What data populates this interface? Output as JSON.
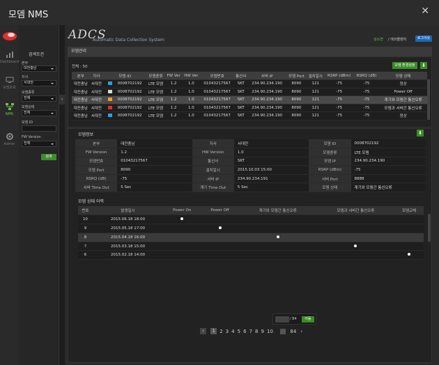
{
  "window": {
    "title": "모뎀 NMS"
  },
  "nav": {
    "items": [
      {
        "label": "Dashboard"
      },
      {
        "label": "모뎀조회"
      },
      {
        "label": "NMS"
      },
      {
        "label": "Admin"
      }
    ]
  },
  "filter": {
    "title": "검색조건",
    "hq_label": "본부",
    "hq_value": "대전충남",
    "office_label": "지사",
    "office_value": "서대전",
    "type_label": "모뎀종류",
    "type_value": "전체",
    "state_label": "모뎀상태",
    "state_value": "전체",
    "id_label": "모뎀 ID",
    "id_value": "",
    "fw_label": "FW Version",
    "fw_value": "전체",
    "search_label": "검색"
  },
  "header": {
    "logo": "ADCS",
    "subtitle": "Automatic Data Collection System",
    "crumb_user": "김소연",
    "crumb_rest": "/ 에코몰랜저",
    "logout": "로그아웃"
  },
  "modem_panel": {
    "title": "모뎀관리",
    "total": "전체 : 50",
    "setting_button": "모뎀 환경설정",
    "columns": [
      "본부",
      "지사",
      "모뎀 ID",
      "모뎀종류",
      "FW Ver",
      "HW Ver",
      "모뎀번호",
      "통신사",
      "서버 IP",
      "모뎀 Port",
      "설치일시",
      "RSRP (dBm)",
      "RSRQ (dB)",
      "모뎀 상태"
    ],
    "rows": [
      {
        "hq": "대전충남",
        "office": "서대전",
        "color": "#2aa2e0",
        "id": "0008702192",
        "type": "LTE 모뎀",
        "fw": "1.2",
        "hw": "1.0",
        "num": "01043217567",
        "telco": "SKT",
        "ip": "234.90.234.190",
        "port": "8090",
        "inst": "121",
        "rsrp": "-75",
        "rsrq": "-75",
        "state": "정상"
      },
      {
        "hq": "대전충남",
        "office": "서대전",
        "color": "#d8d8d8",
        "id": "0008702192",
        "type": "LTE 모뎀",
        "fw": "1.2",
        "hw": "1.0",
        "num": "01043217567",
        "telco": "SKT",
        "ip": "234.90.234.190",
        "port": "8090",
        "inst": "121",
        "rsrp": "-75",
        "rsrq": "-75",
        "state": "Power Off"
      },
      {
        "hq": "대전충남",
        "office": "서대전",
        "color": "#f0a020",
        "id": "0008702192",
        "type": "LTE 모뎀",
        "fw": "1.2",
        "hw": "1.0",
        "num": "01043217567",
        "telco": "SKT",
        "ip": "234.90.234.190",
        "port": "8090",
        "inst": "121",
        "rsrp": "-75",
        "rsrq": "-75",
        "state": "계기와 모뎀간 통신오류"
      },
      {
        "hq": "대전충남",
        "office": "서대전",
        "color": "#e03030",
        "id": "0008702192",
        "type": "LTE 모뎀",
        "fw": "1.2",
        "hw": "1.0",
        "num": "01043217567",
        "telco": "SKT",
        "ip": "234.90.234.190",
        "port": "8090",
        "inst": "121",
        "rsrp": "-75",
        "rsrq": "-75",
        "state": "모뎀과 서버간 통신오류"
      },
      {
        "hq": "대전충남",
        "office": "서대전",
        "color": "#2aa2e0",
        "id": "0008702192",
        "type": "LTE 모뎀",
        "fw": "1.2",
        "hw": "1.0",
        "num": "01043217567",
        "telco": "SKT",
        "ip": "234.90.234.190",
        "port": "8090",
        "inst": "121",
        "rsrp": "-75",
        "rsrq": "-75",
        "state": "정상"
      }
    ]
  },
  "info": {
    "title": "모뎀정보",
    "rows": [
      [
        [
          "본부",
          "대전충남"
        ],
        [
          "지사",
          "서대전"
        ],
        [
          "모뎀 ID",
          "0008702192"
        ]
      ],
      [
        [
          "FW Version",
          "1.2"
        ],
        [
          "HW Version",
          "1.0"
        ],
        [
          "모뎀종류",
          "LTE 모뎀"
        ]
      ],
      [
        [
          "모뎀번호",
          "01043217567"
        ],
        [
          "통신사",
          "SKT"
        ],
        [
          "모뎀 IP",
          "234.90.234.190"
        ]
      ],
      [
        [
          "모뎀 Port",
          "8090"
        ],
        [
          "설치일시",
          "2015.10.03  15:00"
        ],
        [
          "RSRP (dBm)",
          "-75"
        ]
      ],
      [
        [
          "RSRQ (dB)",
          "-75"
        ],
        [
          "서버 IP",
          "234.90.234.191"
        ],
        [
          "서버 Port",
          "8888"
        ]
      ],
      [
        [
          "서버 Time Out",
          "5 Sec"
        ],
        [
          "계기 Time Out",
          "5 Sec"
        ],
        [
          "모뎀 상태",
          "계기와 모뎀간 통신오류"
        ]
      ]
    ]
  },
  "history": {
    "title": "모뎀 상태 이력",
    "columns": [
      "번호",
      "발생일시",
      "Power On",
      "Power Off",
      "계기와 모뎀간 통신오류",
      "모뎀과 서버간 통신오류",
      "모뎀교체"
    ],
    "rows": [
      {
        "no": "10",
        "date": "2015.06.18  18:00",
        "col": 0
      },
      {
        "no": "9",
        "date": "2015.05.18  17:00",
        "col": 1
      },
      {
        "no": "8",
        "date": "2015.04.18  16:00",
        "col": 2
      },
      {
        "no": "7",
        "date": "2015.03.18  15:00",
        "col": 3
      },
      {
        "no": "6",
        "date": "2015.02.18  14:00",
        "col": 4
      }
    ]
  },
  "pagination": {
    "total": "/ 84",
    "go": "이동",
    "pages": [
      "1",
      "2",
      "3",
      "4",
      "5",
      "6",
      "7",
      "8",
      "9",
      "10"
    ],
    "last": "84"
  }
}
